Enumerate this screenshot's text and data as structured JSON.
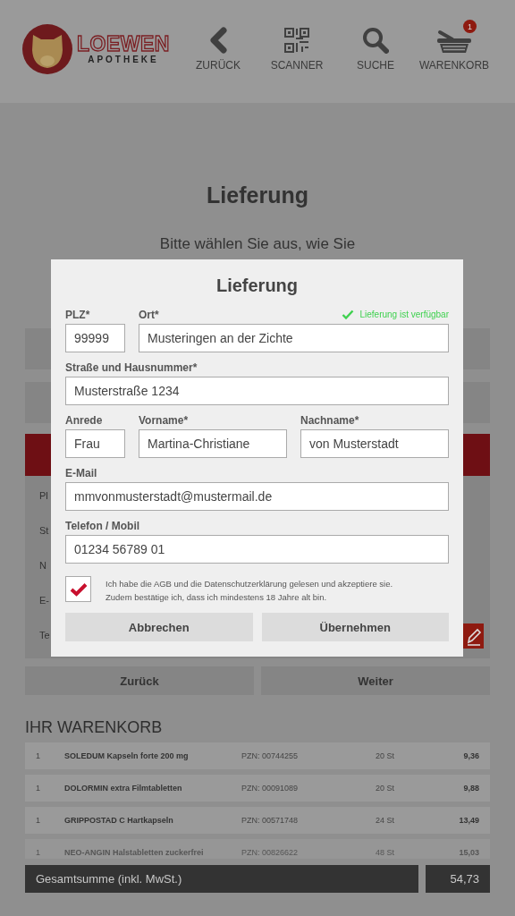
{
  "header": {
    "logo": {
      "name": "LOEWEN",
      "subtitle": "APOTHEKE"
    },
    "nav": [
      {
        "kind": "back",
        "label": "ZURÜCK"
      },
      {
        "kind": "scanner",
        "label": "SCANNER"
      },
      {
        "kind": "search",
        "label": "SUCHE"
      },
      {
        "kind": "cart",
        "label": "WARENKORB",
        "badge": "1"
      }
    ]
  },
  "page": {
    "title": "Lieferung",
    "intro": "Bitte wählen Sie aus, wie Sie",
    "address_labels": [
      "Pl",
      "St",
      "N",
      "E-",
      "Te"
    ],
    "buttons": [
      "Zurück",
      "Weiter"
    ],
    "cart": {
      "title": "IHR WARENKORB",
      "rows": [
        {
          "qty": "1",
          "name": "SOLEDUM Kapseln forte 200 mg",
          "pzn": "PZN: 00744255",
          "amount": "20 St",
          "price": "9,36",
          "faded": false
        },
        {
          "qty": "1",
          "name": "DOLORMIN extra Filmtabletten",
          "pzn": "PZN: 00091089",
          "amount": "20 St",
          "price": "9,88",
          "faded": false
        },
        {
          "qty": "1",
          "name": "GRIPPOSTAD C Hartkapseln",
          "pzn": "PZN: 00571748",
          "amount": "24 St",
          "price": "13,49",
          "faded": false
        },
        {
          "qty": "1",
          "name": "NEO-ANGIN Halstabletten zuckerfrei",
          "pzn": "PZN: 00826622",
          "amount": "48 St",
          "price": "15,03",
          "faded": true
        }
      ]
    },
    "total": {
      "label": "Gesamtsumme (inkl. MwSt.)",
      "value": "54,73"
    }
  },
  "dialog": {
    "title": "Lieferung",
    "availability": "Lieferung ist verfügbar",
    "rows": [
      [
        {
          "label": "PLZ*",
          "value": "99999"
        },
        {
          "label": "Ort*",
          "value": "Musteringen an der Zichte"
        }
      ],
      [
        {
          "label": "Straße und Hausnummer*",
          "value": "Musterstraße 1234"
        }
      ],
      [
        {
          "label": "Anrede",
          "value": "Frau"
        },
        {
          "label": "Vorname*",
          "value": "Martina-Christiane"
        },
        {
          "label": "Nachname*",
          "value": "von Musterstadt"
        }
      ],
      [
        {
          "label": "E-Mail",
          "value": "mmvonmusterstadt@mustermail.de"
        }
      ],
      [
        {
          "label": "Telefon / Mobil",
          "value": "01234 56789 01"
        }
      ]
    ],
    "consent": {
      "checked": true,
      "lines": [
        "Ich habe die AGB und die Datenschutzerklärung gelesen und akzeptiere sie.",
        "Zudem bestätige ich, dass ich mindestens 18 Jahre alt bin."
      ]
    },
    "buttons": [
      "Abbrechen",
      "Übernehmen"
    ]
  }
}
